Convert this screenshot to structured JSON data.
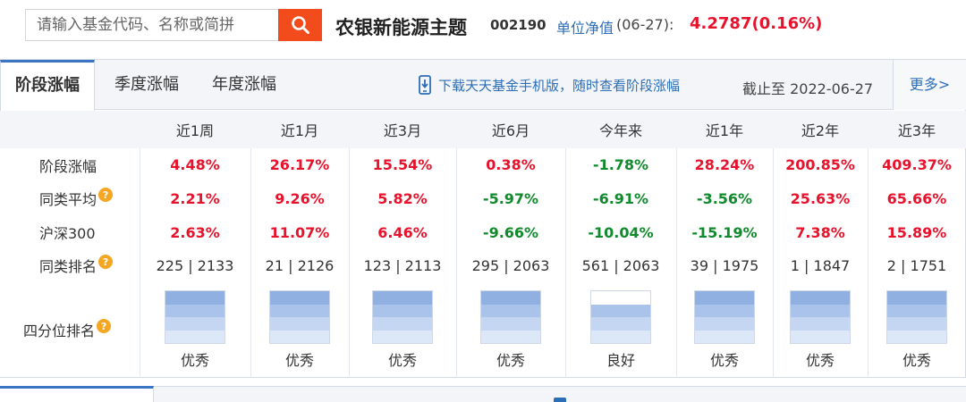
{
  "search": {
    "placeholder": "请输入基金代码、名称或简拼"
  },
  "fund": {
    "name": "农银新能源主题",
    "code": "002190",
    "nav_label": "单位净值",
    "nav_date": "(06-27):",
    "nav_value": "4.2787",
    "nav_change": "(0.16%)"
  },
  "tabs": [
    "阶段涨幅",
    "季度涨幅",
    "年度涨幅"
  ],
  "download_text": "下载天天基金手机版，随时查看阶段涨幅",
  "deadline": "截止至  2022-06-27",
  "more_label": "更多>",
  "columns": [
    "近1周",
    "近1月",
    "近3月",
    "近6月",
    "今年来",
    "近1年",
    "近2年",
    "近3年"
  ],
  "rows": {
    "stage": {
      "label": "阶段涨幅",
      "values": [
        "4.48%",
        "26.17%",
        "15.54%",
        "0.38%",
        "-1.78%",
        "28.24%",
        "200.85%",
        "409.37%"
      ]
    },
    "peer_avg": {
      "label": "同类平均",
      "values": [
        "2.21%",
        "9.26%",
        "5.82%",
        "-5.97%",
        "-6.91%",
        "-3.56%",
        "25.63%",
        "65.66%"
      ]
    },
    "hs300": {
      "label": "沪深300",
      "values": [
        "2.63%",
        "11.07%",
        "6.46%",
        "-9.66%",
        "-10.04%",
        "-15.19%",
        "7.38%",
        "15.89%"
      ]
    },
    "rank": {
      "label": "同类排名",
      "values": [
        "225 | 2133",
        "21 | 2126",
        "123 | 2113",
        "295 | 2063",
        "561 | 2063",
        "39 | 1975",
        "1 | 1847",
        "2 | 1751"
      ]
    },
    "quartile": {
      "label": "四分位排名",
      "levels": [
        4,
        4,
        4,
        4,
        3,
        4,
        4,
        4
      ],
      "labels": [
        "优秀",
        "优秀",
        "优秀",
        "优秀",
        "良好",
        "优秀",
        "优秀",
        "优秀"
      ]
    }
  },
  "help_glyph": "?",
  "colors": {
    "up": "#e8122c",
    "down": "#0f8a2c",
    "link": "#2c6eb8",
    "search_button": "#f24c1d",
    "accent": "#3b74c5"
  },
  "icons": {
    "search": "search-icon",
    "phone": "phone-icon",
    "help": "question-icon"
  }
}
